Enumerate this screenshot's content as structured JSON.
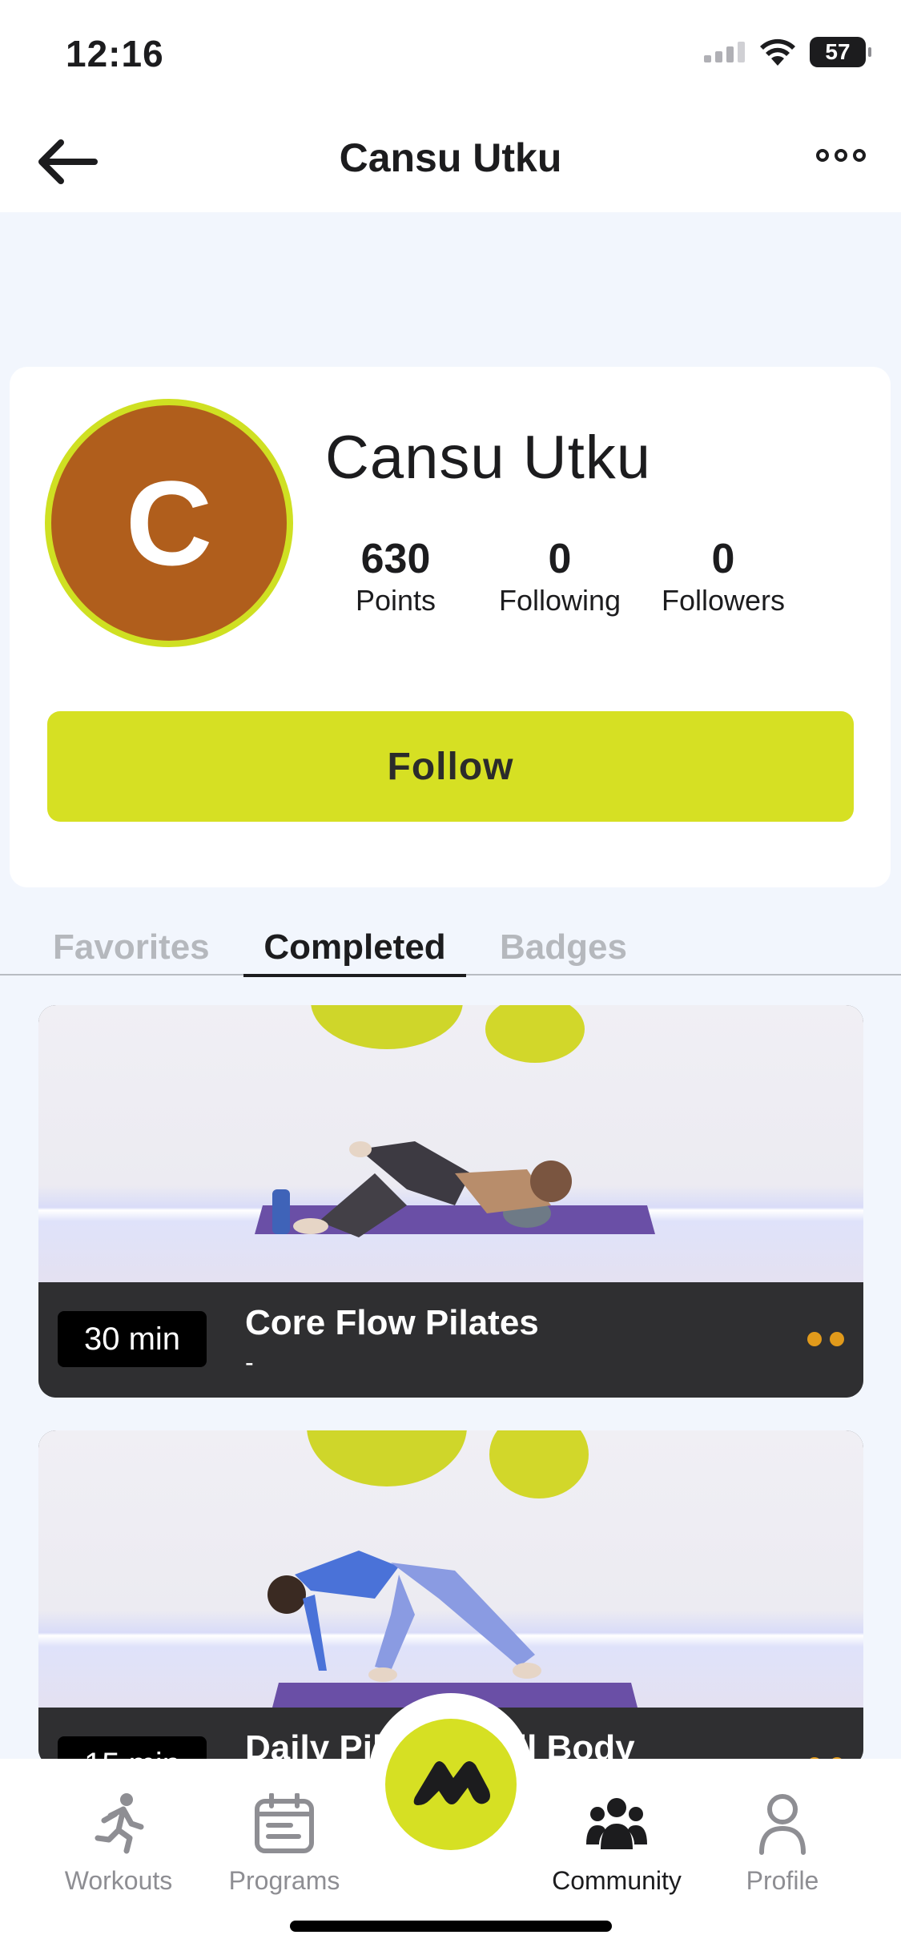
{
  "status_bar": {
    "time": "12:16",
    "battery": "57"
  },
  "nav": {
    "title": "Cansu Utku"
  },
  "profile": {
    "initial": "C",
    "name": "Cansu Utku",
    "avatar_color": "#b05e1c",
    "avatar_ring_color": "#cfe022",
    "stats": {
      "points_value": "630",
      "points_label": "Points",
      "following_value": "0",
      "following_label": "Following",
      "followers_value": "0",
      "followers_label": "Followers"
    },
    "follow_label": "Follow"
  },
  "tabs": {
    "favorites": "Favorites",
    "completed": "Completed",
    "badges": "Badges",
    "active": "Completed"
  },
  "workouts": [
    {
      "duration": "30 min",
      "title": "Core Flow Pilates",
      "subtitle": "-"
    },
    {
      "duration": "15 min",
      "title": "Daily Pilates: Full Body",
      "subtitle": ""
    }
  ],
  "tab_bar": {
    "workouts": "Workouts",
    "programs": "Programs",
    "community": "Community",
    "profile": "Profile",
    "active": "Community"
  },
  "colors": {
    "accent": "#d6e023",
    "dots": "#e19a1b",
    "card": "#2f2f31"
  }
}
